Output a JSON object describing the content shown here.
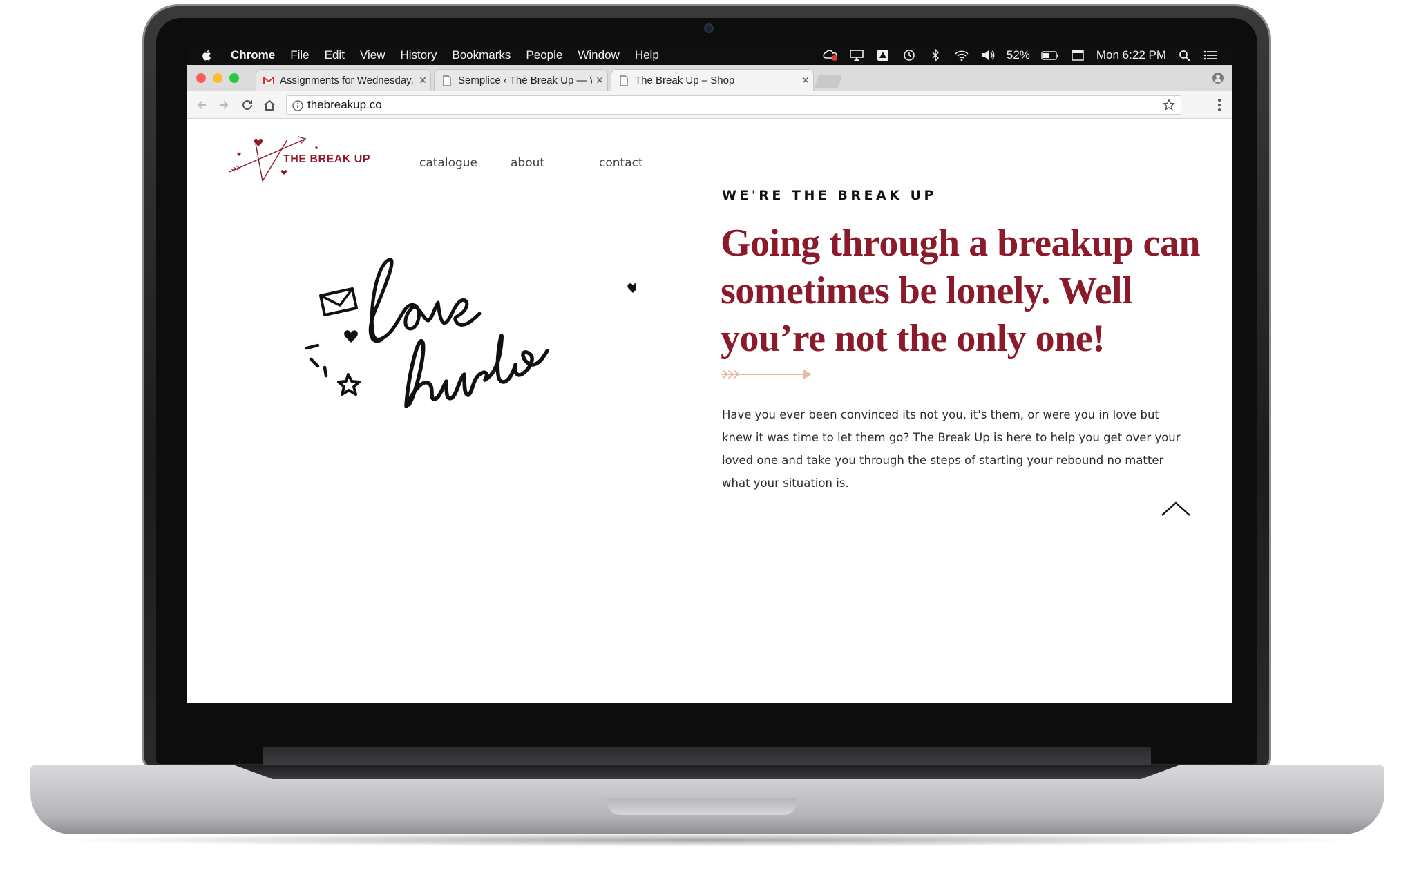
{
  "menubar": {
    "app_name": "Chrome",
    "items": [
      "File",
      "Edit",
      "View",
      "History",
      "Bookmarks",
      "People",
      "Window",
      "Help"
    ],
    "battery": "52%",
    "clock": "Mon 6:22 PM"
  },
  "tabs": [
    {
      "title": "Assignments for Wednesday, M",
      "icon": "gmail-icon"
    },
    {
      "title": "Semplice ‹ The Break Up — W",
      "icon": "page-icon"
    },
    {
      "title": "The Break Up – Shop",
      "icon": "page-icon"
    }
  ],
  "address_bar": {
    "url": "thebreakup.co"
  },
  "site": {
    "logo_text": "THE BREAK UP",
    "nav": [
      "catalogue",
      "about",
      "contact"
    ],
    "eyebrow": "WE'RE THE BREAK UP",
    "headline": "Going through a breakup can sometimes be lonely. Well you’re not the only one!",
    "body": "Have you ever been convinced its not you, it's them, or were you in love but knew it was time to let them go? The Break Up is here to help you get over your loved one and take you through the steps of starting your rebound no matter what your situation is.",
    "hero_art_text": [
      "love",
      "hurts"
    ],
    "accent_color": "#8b1a2b",
    "arrow_color": "#e9b9a6"
  }
}
